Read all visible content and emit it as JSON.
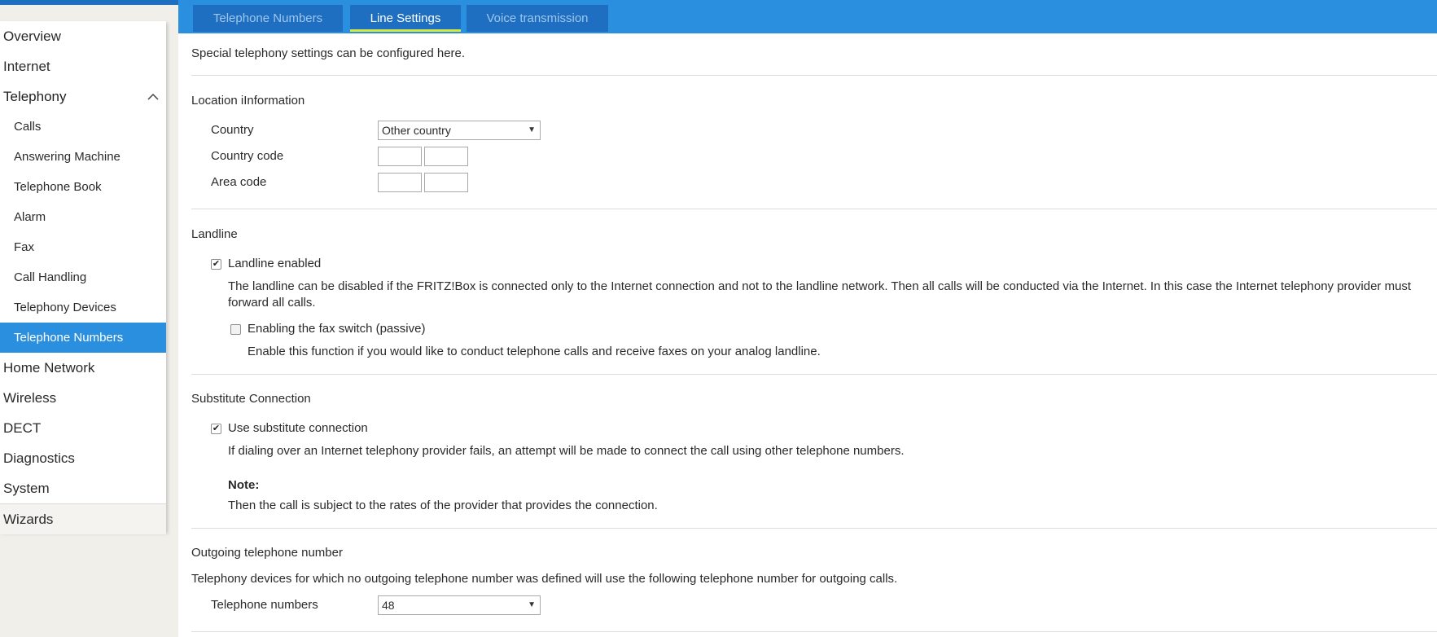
{
  "sidebar": {
    "items": [
      {
        "label": "Overview"
      },
      {
        "label": "Internet"
      },
      {
        "label": "Telephony"
      },
      {
        "label": "Calls"
      },
      {
        "label": "Answering Machine"
      },
      {
        "label": "Telephone Book"
      },
      {
        "label": "Alarm"
      },
      {
        "label": "Fax"
      },
      {
        "label": "Call Handling"
      },
      {
        "label": "Telephony Devices"
      },
      {
        "label": "Telephone Numbers"
      },
      {
        "label": "Home Network"
      },
      {
        "label": "Wireless"
      },
      {
        "label": "DECT"
      },
      {
        "label": "Diagnostics"
      },
      {
        "label": "System"
      },
      {
        "label": "Wizards"
      }
    ]
  },
  "tabs": [
    {
      "label": "Telephone Numbers"
    },
    {
      "label": "Line Settings"
    },
    {
      "label": "Voice transmission"
    }
  ],
  "intro": "Special telephony settings can be configured here.",
  "location": {
    "title": "Location iInformation",
    "country_label": "Country",
    "country_value": "Other country",
    "country_code_label": "Country code",
    "area_code_label": "Area code"
  },
  "landline": {
    "title": "Landline",
    "enabled_label": "Landline enabled",
    "enabled_checked": true,
    "enabled_desc": "The landline can be disabled if the FRITZ!Box is connected only to the Internet connection and not to the landline network. Then all calls will be conducted via the Internet. In this case the Internet telephony provider must forward all calls.",
    "fax_label": "Enabling the fax switch (passive)",
    "fax_checked": false,
    "fax_desc": "Enable this function if you would like to conduct telephone calls and receive faxes on your analog landline."
  },
  "substitute": {
    "title": "Substitute Connection",
    "use_label": "Use substitute connection",
    "use_checked": true,
    "use_desc": "If dialing over an Internet telephony provider fails, an attempt will be made to connect the call using other telephone numbers.",
    "note_title": "Note:",
    "note_text": "Then the call is subject to the rates of the provider that provides the connection."
  },
  "outgoing": {
    "title": "Outgoing telephone number",
    "desc": "Telephony devices for which no outgoing telephone number was defined will use the following telephone number for outgoing calls.",
    "numbers_label": "Telephone numbers",
    "numbers_value": "48"
  },
  "colors": {
    "accent": "#2b8fe0",
    "tab_bg": "#1e6ec1",
    "tab_active_underline": "#d7e83a"
  }
}
